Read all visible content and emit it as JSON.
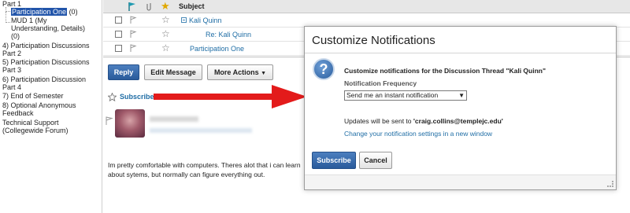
{
  "tree": {
    "items": [
      {
        "label": "Part 1"
      },
      {
        "label": "Participation One",
        "count": "(0)",
        "selected": true
      },
      {
        "label": "MUD 1 (My"
      },
      {
        "label": "Understanding, Details)"
      },
      {
        "label": "(0)"
      },
      {
        "label": "4) Participation Discussions"
      },
      {
        "label": "Part 2"
      },
      {
        "label": "5) Participation Discussions"
      },
      {
        "label": "Part 3"
      },
      {
        "label": "6) Participation Discussion"
      },
      {
        "label": "Part 4"
      },
      {
        "label": "7) End of Semester"
      },
      {
        "label": "8) Optional Anonymous"
      },
      {
        "label": "Feedback"
      },
      {
        "label": "Technical Support"
      },
      {
        "label": "(Collegewide Forum)"
      }
    ]
  },
  "list": {
    "header": {
      "subject": "Subject"
    },
    "rows": [
      {
        "subject": "Kali Quinn"
      },
      {
        "subject": "Re: Kali Quinn"
      },
      {
        "subject": "Participation One"
      }
    ]
  },
  "message": {
    "buttons": {
      "reply": "Reply",
      "edit": "Edit Message",
      "more": "More Actions"
    },
    "subscribe": "Subscribe",
    "body": "Im pretty comfortable with computers. Theres alot that i can learn about sytems, but normally can figure everything out."
  },
  "modal": {
    "title": "Customize Notifications",
    "heading": "Customize notifications for the Discussion Thread \"Kali Quinn\"",
    "frequency_label": "Notification Frequency",
    "frequency_value": "Send me an instant notification",
    "updates_prefix": "Updates will be sent to ",
    "updates_email": "'craig.collins@templejc.edu'",
    "change_link": "Change your notification settings in a new window",
    "subscribe_button": "Subscribe",
    "cancel_button": "Cancel"
  },
  "colors": {
    "accent": "#2a5b9b",
    "link": "#1f6da5",
    "arrow": "#e31b1b",
    "selected": "#2255aa"
  }
}
